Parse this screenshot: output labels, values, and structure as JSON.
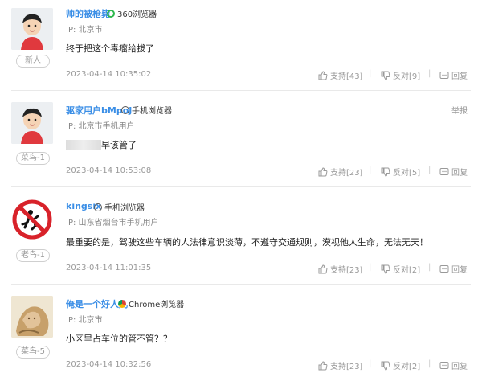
{
  "comments": [
    {
      "username": "帅的被枪毙",
      "browser": "360浏览器",
      "ip": "IP: 北京市",
      "text": "终于把这个毒瘤给拔了",
      "time": "2023-04-14 10:35:02",
      "support": "支持[43]",
      "oppose": "反对[9]",
      "reply": "回复",
      "badge": "新人"
    },
    {
      "username": "驱家用户bMpoJ",
      "browser": "手机浏览器",
      "ip": "IP: 北京市手机用户",
      "text": "早该管了",
      "time": "2023-04-14 10:53:08",
      "support": "支持[23]",
      "oppose": "反对[5]",
      "reply": "回复",
      "badge": "菜鸟-1",
      "report": "举报"
    },
    {
      "username": "kingsix",
      "browser": "手机浏览器",
      "ip": "IP: 山东省烟台市手机用户",
      "text": "最重要的是，驾驶这些车辆的人法律意识淡薄，不遵守交通规则，漠视他人生命，无法无天！",
      "time": "2023-04-14 11:01:35",
      "support": "支持[23]",
      "oppose": "反对[2]",
      "reply": "回复",
      "badge": "老鸟-1"
    },
    {
      "username": "俺是一个好人儿",
      "browser": "Chrome浏览器",
      "ip": "IP: 北京市",
      "text": "小区里占车位的管不管？？",
      "time": "2023-04-14 10:32:56",
      "support": "支持[23]",
      "oppose": "反对[2]",
      "reply": "回复",
      "badge": "菜鸟-5"
    }
  ],
  "icons": {
    "support": "thumbs-up-icon",
    "oppose": "thumbs-down-icon",
    "reply": "reply-bubble-icon",
    "browser_360": "360-browser-icon",
    "browser_mobile": "mobile-browser-icon",
    "browser_chrome": "chrome-icon"
  },
  "colors": {
    "username": "#3a8ee6",
    "muted": "#999999",
    "divider": "#e9e9e9"
  }
}
